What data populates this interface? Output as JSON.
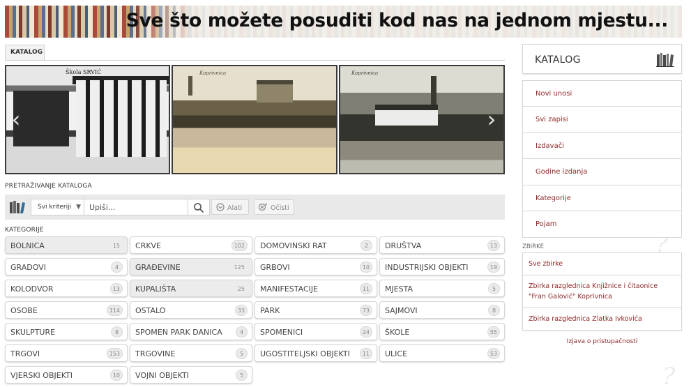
{
  "banner": {
    "text": "Sve što možete posuditi kod nas na jednom mjestu..."
  },
  "tabs": {
    "active": "KATALOG"
  },
  "carousel": {
    "captions": [
      "Škola SRVIĆ",
      "Koprivnica",
      "Koprivnica"
    ],
    "prev_glyph": "‹",
    "next_glyph": "›"
  },
  "search": {
    "section_title": "PRETRAŽIVANJE KATALOGA",
    "criteria_value": "Svi kriteriji",
    "input_placeholder": "Upiši...",
    "tools_label": "Alati",
    "clear_label": "Očisti"
  },
  "categories": {
    "title": "KATEGORIJE",
    "items": [
      {
        "label": "BOLNICA",
        "count": "15"
      },
      {
        "label": "CRKVE",
        "count": "102"
      },
      {
        "label": "DOMOVINSKI RAT",
        "count": "2"
      },
      {
        "label": "DRUŠTVA",
        "count": "13"
      },
      {
        "label": "GRADOVI",
        "count": "4"
      },
      {
        "label": "GRAĐEVINE",
        "count": "125"
      },
      {
        "label": "GRBOVI",
        "count": "10"
      },
      {
        "label": "INDUSTRIJSKI OBJEKTI",
        "count": "19"
      },
      {
        "label": "KOLODVOR",
        "count": "13"
      },
      {
        "label": "KUPALIŠTA",
        "count": "25"
      },
      {
        "label": "MANIFESTACIJE",
        "count": "11"
      },
      {
        "label": "MJESTA",
        "count": "5"
      },
      {
        "label": "OSOBE",
        "count": "114"
      },
      {
        "label": "OSTALO",
        "count": "33"
      },
      {
        "label": "PARK",
        "count": "73"
      },
      {
        "label": "SAJMOVI",
        "count": "8"
      },
      {
        "label": "SKULPTURE",
        "count": "8"
      },
      {
        "label": "SPOMEN PARK DANICA",
        "count": "4"
      },
      {
        "label": "SPOMENICI",
        "count": "24"
      },
      {
        "label": "ŠKOLE",
        "count": "55"
      },
      {
        "label": "TRGOVI",
        "count": "153"
      },
      {
        "label": "TRGOVINE",
        "count": "5"
      },
      {
        "label": "UGOSTITELJSKI OBJEKTI",
        "count": "11"
      },
      {
        "label": "ULICE",
        "count": "53"
      },
      {
        "label": "VJERSKI OBJEKTI",
        "count": "10"
      },
      {
        "label": "VOJNI OBJEKTI",
        "count": "5"
      }
    ]
  },
  "sidebar": {
    "title": "KATALOG",
    "menu": [
      "Novi unosi",
      "Svi zapisi",
      "Izdavači",
      "Godine izdanja",
      "Kategorije",
      "Pojam"
    ],
    "collections_label": "ZBIRKE",
    "collections": [
      "Sve zbirke",
      "Zbirka razglednica Knjižnice i čitaonice \"Fran Galović\" Koprivnica",
      "Zbirka razglednica Zlatka Ivkovića"
    ],
    "accessibility_link": "Izjava o pristupačnosti"
  },
  "colors": {
    "link": "#8e2828",
    "panel": "#e9e9e9",
    "banner_text": "#111111"
  },
  "icons": [
    "books-icon",
    "search-icon",
    "tools-icon",
    "clear-icon",
    "chevron-down-icon"
  ]
}
